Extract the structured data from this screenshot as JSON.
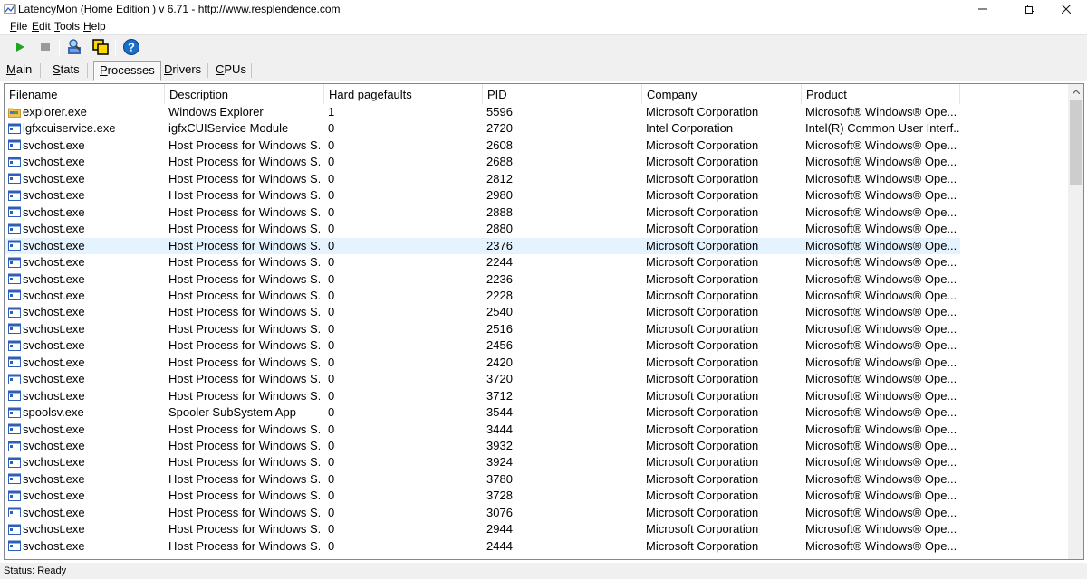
{
  "window": {
    "title": "LatencyMon  (Home Edition )  v 6.71 - http://www.resplendence.com",
    "icon": "latencymon-app-icon"
  },
  "menu": {
    "items": [
      {
        "label": "File",
        "mnemonic": "F"
      },
      {
        "label": "Edit",
        "mnemonic": "E"
      },
      {
        "label": "Tools",
        "mnemonic": "T"
      },
      {
        "label": "Help",
        "mnemonic": "H"
      }
    ]
  },
  "toolbar": {
    "buttons": [
      "play-icon",
      "stop-icon",
      "search-tool-icon",
      "windows-icon",
      "help-icon"
    ]
  },
  "tabs": {
    "items": [
      {
        "label": "Main",
        "mnemonic": "M"
      },
      {
        "label": "Stats",
        "mnemonic": "S"
      },
      {
        "label": "Processes",
        "mnemonic": "P"
      },
      {
        "label": "Drivers",
        "mnemonic": "D"
      },
      {
        "label": "CPUs",
        "mnemonic": "C"
      }
    ],
    "active": "Processes"
  },
  "table": {
    "columns": [
      "Filename",
      "Description",
      "Hard pagefaults",
      "PID",
      "Company",
      "Product"
    ],
    "selected_row": 8,
    "rows": [
      {
        "icon": "folder-icon",
        "filename": "explorer.exe",
        "description": "Windows Explorer",
        "hard_pagefaults": "1",
        "pid": "5596",
        "company": "Microsoft Corporation",
        "product": "Microsoft® Windows® Ope..."
      },
      {
        "icon": "app-window-icon",
        "filename": "igfxcuiservice.exe",
        "description": "igfxCUIService Module",
        "hard_pagefaults": "0",
        "pid": "2720",
        "company": "Intel Corporation",
        "product": "Intel(R) Common User Interf..."
      },
      {
        "icon": "app-window-icon",
        "filename": "svchost.exe",
        "description": "Host Process for Windows S...",
        "hard_pagefaults": "0",
        "pid": "2608",
        "company": "Microsoft Corporation",
        "product": "Microsoft® Windows® Ope..."
      },
      {
        "icon": "app-window-icon",
        "filename": "svchost.exe",
        "description": "Host Process for Windows S...",
        "hard_pagefaults": "0",
        "pid": "2688",
        "company": "Microsoft Corporation",
        "product": "Microsoft® Windows® Ope..."
      },
      {
        "icon": "app-window-icon",
        "filename": "svchost.exe",
        "description": "Host Process for Windows S...",
        "hard_pagefaults": "0",
        "pid": "2812",
        "company": "Microsoft Corporation",
        "product": "Microsoft® Windows® Ope..."
      },
      {
        "icon": "app-window-icon",
        "filename": "svchost.exe",
        "description": "Host Process for Windows S...",
        "hard_pagefaults": "0",
        "pid": "2980",
        "company": "Microsoft Corporation",
        "product": "Microsoft® Windows® Ope..."
      },
      {
        "icon": "app-window-icon",
        "filename": "svchost.exe",
        "description": "Host Process for Windows S...",
        "hard_pagefaults": "0",
        "pid": "2888",
        "company": "Microsoft Corporation",
        "product": "Microsoft® Windows® Ope..."
      },
      {
        "icon": "app-window-icon",
        "filename": "svchost.exe",
        "description": "Host Process for Windows S...",
        "hard_pagefaults": "0",
        "pid": "2880",
        "company": "Microsoft Corporation",
        "product": "Microsoft® Windows® Ope..."
      },
      {
        "icon": "app-window-icon",
        "filename": "svchost.exe",
        "description": "Host Process for Windows S...",
        "hard_pagefaults": "0",
        "pid": "2376",
        "company": "Microsoft Corporation",
        "product": "Microsoft® Windows® Ope..."
      },
      {
        "icon": "app-window-icon",
        "filename": "svchost.exe",
        "description": "Host Process for Windows S...",
        "hard_pagefaults": "0",
        "pid": "2244",
        "company": "Microsoft Corporation",
        "product": "Microsoft® Windows® Ope..."
      },
      {
        "icon": "app-window-icon",
        "filename": "svchost.exe",
        "description": "Host Process for Windows S...",
        "hard_pagefaults": "0",
        "pid": "2236",
        "company": "Microsoft Corporation",
        "product": "Microsoft® Windows® Ope..."
      },
      {
        "icon": "app-window-icon",
        "filename": "svchost.exe",
        "description": "Host Process for Windows S...",
        "hard_pagefaults": "0",
        "pid": "2228",
        "company": "Microsoft Corporation",
        "product": "Microsoft® Windows® Ope..."
      },
      {
        "icon": "app-window-icon",
        "filename": "svchost.exe",
        "description": "Host Process for Windows S...",
        "hard_pagefaults": "0",
        "pid": "2540",
        "company": "Microsoft Corporation",
        "product": "Microsoft® Windows® Ope..."
      },
      {
        "icon": "app-window-icon",
        "filename": "svchost.exe",
        "description": "Host Process for Windows S...",
        "hard_pagefaults": "0",
        "pid": "2516",
        "company": "Microsoft Corporation",
        "product": "Microsoft® Windows® Ope..."
      },
      {
        "icon": "app-window-icon",
        "filename": "svchost.exe",
        "description": "Host Process for Windows S...",
        "hard_pagefaults": "0",
        "pid": "2456",
        "company": "Microsoft Corporation",
        "product": "Microsoft® Windows® Ope..."
      },
      {
        "icon": "app-window-icon",
        "filename": "svchost.exe",
        "description": "Host Process for Windows S...",
        "hard_pagefaults": "0",
        "pid": "2420",
        "company": "Microsoft Corporation",
        "product": "Microsoft® Windows® Ope..."
      },
      {
        "icon": "app-window-icon",
        "filename": "svchost.exe",
        "description": "Host Process for Windows S...",
        "hard_pagefaults": "0",
        "pid": "3720",
        "company": "Microsoft Corporation",
        "product": "Microsoft® Windows® Ope..."
      },
      {
        "icon": "app-window-icon",
        "filename": "svchost.exe",
        "description": "Host Process for Windows S...",
        "hard_pagefaults": "0",
        "pid": "3712",
        "company": "Microsoft Corporation",
        "product": "Microsoft® Windows® Ope..."
      },
      {
        "icon": "app-window-icon",
        "filename": "spoolsv.exe",
        "description": "Spooler SubSystem App",
        "hard_pagefaults": "0",
        "pid": "3544",
        "company": "Microsoft Corporation",
        "product": "Microsoft® Windows® Ope..."
      },
      {
        "icon": "app-window-icon",
        "filename": "svchost.exe",
        "description": "Host Process for Windows S...",
        "hard_pagefaults": "0",
        "pid": "3444",
        "company": "Microsoft Corporation",
        "product": "Microsoft® Windows® Ope..."
      },
      {
        "icon": "app-window-icon",
        "filename": "svchost.exe",
        "description": "Host Process for Windows S...",
        "hard_pagefaults": "0",
        "pid": "3932",
        "company": "Microsoft Corporation",
        "product": "Microsoft® Windows® Ope..."
      },
      {
        "icon": "app-window-icon",
        "filename": "svchost.exe",
        "description": "Host Process for Windows S...",
        "hard_pagefaults": "0",
        "pid": "3924",
        "company": "Microsoft Corporation",
        "product": "Microsoft® Windows® Ope..."
      },
      {
        "icon": "app-window-icon",
        "filename": "svchost.exe",
        "description": "Host Process for Windows S...",
        "hard_pagefaults": "0",
        "pid": "3780",
        "company": "Microsoft Corporation",
        "product": "Microsoft® Windows® Ope..."
      },
      {
        "icon": "app-window-icon",
        "filename": "svchost.exe",
        "description": "Host Process for Windows S...",
        "hard_pagefaults": "0",
        "pid": "3728",
        "company": "Microsoft Corporation",
        "product": "Microsoft® Windows® Ope..."
      },
      {
        "icon": "app-window-icon",
        "filename": "svchost.exe",
        "description": "Host Process for Windows S...",
        "hard_pagefaults": "0",
        "pid": "3076",
        "company": "Microsoft Corporation",
        "product": "Microsoft® Windows® Ope..."
      },
      {
        "icon": "app-window-icon",
        "filename": "svchost.exe",
        "description": "Host Process for Windows S...",
        "hard_pagefaults": "0",
        "pid": "2944",
        "company": "Microsoft Corporation",
        "product": "Microsoft® Windows® Ope..."
      },
      {
        "icon": "app-window-icon",
        "filename": "svchost.exe",
        "description": "Host Process for Windows S...",
        "hard_pagefaults": "0",
        "pid": "2444",
        "company": "Microsoft Corporation",
        "product": "Microsoft® Windows® Ope..."
      }
    ]
  },
  "status": {
    "text": "Status: Ready"
  },
  "colors": {
    "selection": "#e5f3ff",
    "chrome": "#f0f0f0",
    "help_icon": "#1c6fc9",
    "play_icon": "#1fa51f"
  }
}
